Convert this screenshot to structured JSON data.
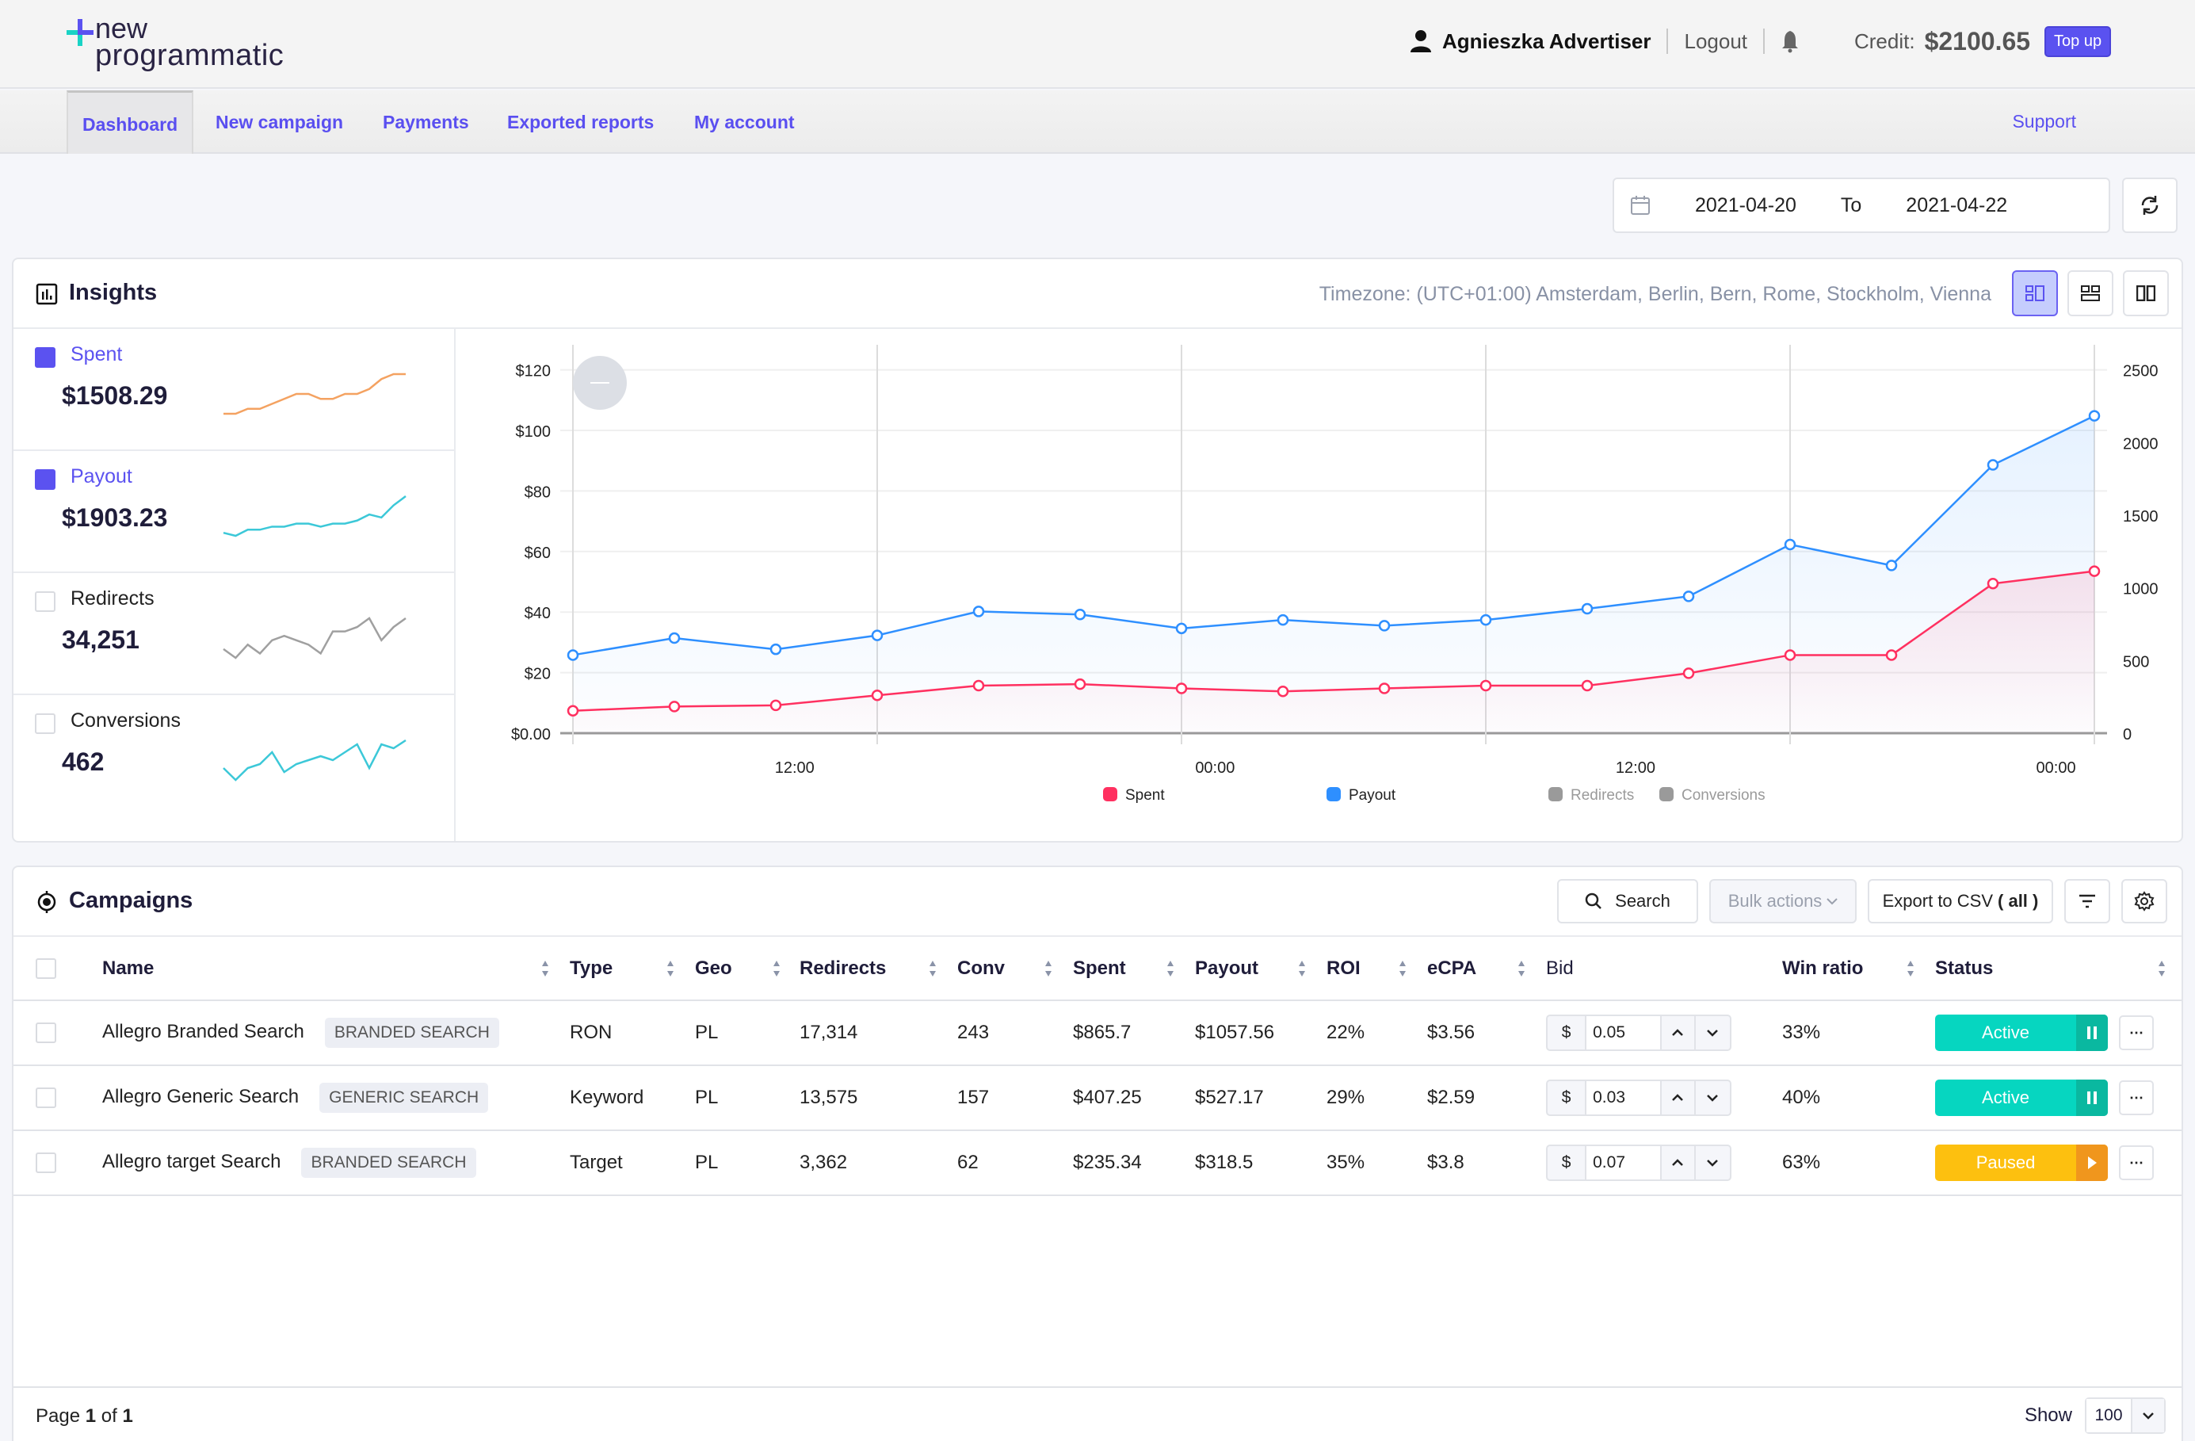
{
  "header": {
    "logo_line1": "new",
    "logo_line2": "programmatic",
    "user_name": "Agnieszka Advertiser",
    "logout_label": "Logout",
    "credit_label": "Credit:",
    "credit_amount": "$2100.65",
    "topup_label": "Top up"
  },
  "nav": {
    "items": [
      {
        "label": "Dashboard",
        "active": true
      },
      {
        "label": "New campaign"
      },
      {
        "label": "Payments"
      },
      {
        "label": "Exported reports"
      },
      {
        "label": "My account"
      }
    ],
    "support_label": "Support"
  },
  "daterange": {
    "from": "2021-04-20",
    "to_label": "To",
    "to": "2021-04-22"
  },
  "insights": {
    "title": "Insights",
    "timezone": "Timezone: (UTC+01:00) Amsterdam, Berlin, Bern, Rome, Stockholm, Vienna",
    "metrics": [
      {
        "label": "Spent",
        "value": "$1508.29",
        "checked": true,
        "spark_color": "#f4a261",
        "spark": [
          2,
          2,
          3,
          3,
          4,
          5,
          6,
          6,
          5,
          5,
          6,
          6,
          7,
          9,
          10,
          10
        ]
      },
      {
        "label": "Payout",
        "value": "$1903.23",
        "checked": true,
        "spark_color": "#3cc8d8",
        "spark": [
          2,
          1,
          3,
          3,
          4,
          4,
          5,
          5,
          4,
          5,
          5,
          6,
          8,
          7,
          11,
          14
        ]
      },
      {
        "label": "Redirects",
        "value": "34,251",
        "checked": false,
        "spark_color": "#a0a0a0",
        "spark": [
          4,
          2,
          5,
          3,
          6,
          7,
          6,
          5,
          3,
          8,
          8,
          9,
          11,
          6,
          9,
          11
        ]
      },
      {
        "label": "Conversions",
        "value": "462",
        "checked": false,
        "spark_color": "#3cc8d8",
        "spark": [
          5,
          2,
          5,
          6,
          9,
          4,
          6,
          7,
          8,
          7,
          9,
          11,
          5,
          11,
          10,
          12
        ]
      }
    ]
  },
  "chart_data": {
    "type": "line",
    "title": "",
    "x": [
      "2021-04-20 00:00",
      "03:00",
      "06:00",
      "09:00",
      "12:00",
      "15:00",
      "18:00",
      "21:00",
      "2021-04-21 00:00",
      "03:00",
      "06:00",
      "09:00",
      "12:00",
      "15:00",
      "18:00",
      "21:00"
    ],
    "xtick_labels": [
      "12:00",
      "00:00",
      "12:00",
      "00:00"
    ],
    "ylabel_left": "$",
    "yticks_left": [
      "$0.00",
      "$20",
      "$40",
      "$60",
      "$80",
      "$100",
      "$120"
    ],
    "ylim_left": [
      0,
      120
    ],
    "yticks_right": [
      "0",
      "500",
      "1000",
      "1500",
      "2000",
      "2500"
    ],
    "ylim_right": [
      0,
      2500
    ],
    "grid": true,
    "legend_position": "bottom",
    "series": [
      {
        "name": "Spent",
        "color": "#ff3060",
        "visible": true,
        "values": [
          7.4,
          8.8,
          9.2,
          12.5,
          15.7,
          16.2,
          14.8,
          13.8,
          14.8,
          15.7,
          15.7,
          19.8,
          25.8,
          25.8,
          49.4,
          53.5
        ]
      },
      {
        "name": "Payout",
        "color": "#2e8fff",
        "visible": true,
        "values": [
          25.8,
          31.4,
          27.7,
          32.3,
          40.2,
          39.2,
          34.6,
          37.4,
          35.5,
          37.4,
          41.1,
          45.2,
          62.3,
          55.4,
          88.6,
          104.8
        ]
      },
      {
        "name": "Redirects",
        "color": "#9a9a9a",
        "visible": false,
        "values": []
      },
      {
        "name": "Conversions",
        "color": "#9a9a9a",
        "visible": false,
        "values": []
      }
    ]
  },
  "campaigns": {
    "title": "Campaigns",
    "search_label": "Search",
    "bulk_label": "Bulk actions",
    "export_label": "Export to CSV",
    "export_scope": "( all )",
    "columns": [
      "Name",
      "Type",
      "Geo",
      "Redirects",
      "Conv",
      "Spent",
      "Payout",
      "ROI",
      "eCPA",
      "Bid",
      "Win ratio",
      "Status"
    ],
    "rows": [
      {
        "name": "Allegro Branded Search",
        "tag": "BRANDED SEARCH",
        "type": "RON",
        "geo": "PL",
        "redirects": "17,314",
        "conv": "243",
        "spent": "$865.7",
        "payout": "$1057.56",
        "roi": "22%",
        "ecpa": "$3.56",
        "bid_currency": "$",
        "bid": "0.05",
        "win_ratio": "33%",
        "status": "Active"
      },
      {
        "name": "Allegro Generic Search",
        "tag": "GENERIC SEARCH",
        "type": "Keyword",
        "geo": "PL",
        "redirects": "13,575",
        "conv": "157",
        "spent": "$407.25",
        "payout": "$527.17",
        "roi": "29%",
        "ecpa": "$2.59",
        "bid_currency": "$",
        "bid": "0.03",
        "win_ratio": "40%",
        "status": "Active"
      },
      {
        "name": "Allegro target Search",
        "tag": "BRANDED SEARCH",
        "type": "Target",
        "geo": "PL",
        "redirects": "3,362",
        "conv": "62",
        "spent": "$235.34",
        "payout": "$318.5",
        "roi": "35%",
        "ecpa": "$3.8",
        "bid_currency": "$",
        "bid": "0.07",
        "win_ratio": "63%",
        "status": "Paused"
      }
    ],
    "status_colors": {
      "Active": "#06d6c0",
      "Active_dark": "#0ab8a0",
      "Paused": "#fdc00f",
      "Paused_dark": "#f0961d"
    },
    "pager": {
      "prefix": "Page",
      "current": "1",
      "of": "of",
      "total": "1"
    },
    "show_label": "Show",
    "page_size": "100"
  }
}
